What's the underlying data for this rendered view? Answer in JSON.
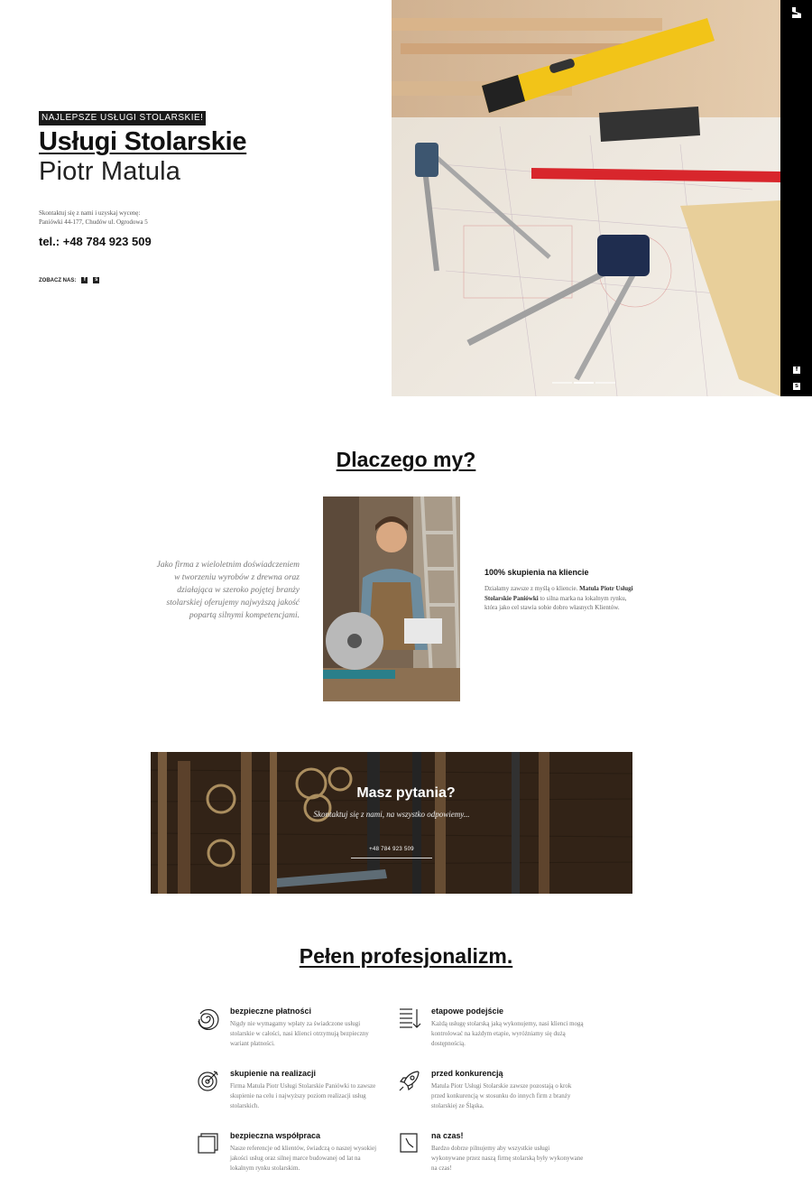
{
  "hero": {
    "badge": "NAJLEPSZE USŁUGI STOLARSKIE!",
    "title": "Usługi Stolarskie",
    "subtitle": "Piotr Matula",
    "contact_line1": "Skontaktuj się z nami i uzyskaj wycenę:",
    "contact_line2": "Paniówki 44-177, Chudów ul. Ogrodowa 5",
    "phone": "tel.: +48 784 923 509",
    "see_us": "ZOBACZ NAS:",
    "social_icons": [
      "facebook-icon",
      "skype-icon"
    ]
  },
  "sidebar": {
    "logo_icon": "site-logo-icon",
    "social_icons": [
      "facebook-icon",
      "skype-icon"
    ]
  },
  "slider": {
    "slide_count": 3,
    "active_index": 1
  },
  "why": {
    "title": "Dlaczego my?",
    "quote": "Jako firma z wieloletnim doświadczeniem w tworzeniu wyrobów z drewna oraz działająca w szeroko pojętej branży stolarskiej oferujemy najwyższą jakość popartą silnymi kompetencjami.",
    "feature_title": "100% skupienia na kliencie",
    "feature_text_a": "Działamy zawsze z myślą o kliencie. ",
    "feature_text_bold": "Matula Piotr Usługi Stolarskie Paniówki",
    "feature_text_b": " to silna marka na lokalnym rynku, która jako cel stawia sobie dobro własnych Klientów."
  },
  "banner": {
    "title": "Masz pytania?",
    "subtitle": "Skontaktuj się z nami, na wszystko odpowiemy...",
    "button": "+48 784 923 509"
  },
  "prof": {
    "title": "Pełen profesjonalizm.",
    "items": [
      {
        "icon": "spiral-icon",
        "title": "bezpieczne płatności",
        "text": "Nigdy nie wymagamy wpłaty za świadczone usługi stolarskie w całości, nasi klienci otrzymują bezpieczny wariant płatności."
      },
      {
        "icon": "list-arrow-icon",
        "title": "etapowe podejście",
        "text": "Każdą usługę stolarską jaką wykonujemy, nasi klienci mogą kontrolować na każdym etapie, wyróżniamy się dużą dostępnością."
      },
      {
        "icon": "target-icon",
        "title": "skupienie na realizacji",
        "text": "Firma Matula Piotr Usługi Stolarskie Paniówki to zawsze skupienie na celu i najwyższy poziom realizacji usług stolarskich."
      },
      {
        "icon": "rocket-icon",
        "title": "przed konkurencją",
        "text": "Matula Piotr Usługi Stolarskie zawsze pozostają o krok przed konkurencją w stosunku do innych firm z branży stolarskiej ze Śląska."
      },
      {
        "icon": "layers-icon",
        "title": "bezpieczna współpraca",
        "text": "Nasze referencje od klientów, świadczą o naszej wysokiej jakości usług oraz silnej marce budowanej od lat na lokalnym rynku stolarskim."
      },
      {
        "icon": "clock-icon",
        "title": "na czas!",
        "text": "Bardzo dobrze pilnujemy aby wszystkie usługi wykonywane przez naszą firmę stolarską były wykonywane na czas!"
      }
    ]
  }
}
